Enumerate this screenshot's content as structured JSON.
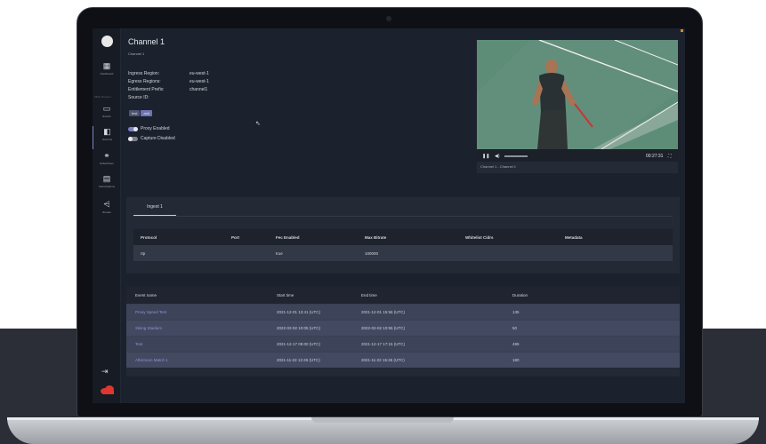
{
  "sidebar": {
    "items": [
      {
        "label": "Dashboard",
        "icon": "dashboard-icon"
      },
      {
        "label": "Events",
        "icon": "events-icon"
      },
      {
        "label": "Sources",
        "icon": "sources-icon"
      },
      {
        "label": "Subscribers",
        "icon": "subscribers-icon"
      },
      {
        "label": "Subscriptions",
        "icon": "subscriptions-icon"
      },
      {
        "label": "Routes",
        "icon": "routes-icon"
      }
    ],
    "section_label": "MDA Channel"
  },
  "channel": {
    "title": "Channel 1",
    "subtitle": "Channel 1",
    "ingress_region_label": "Ingress Region:",
    "ingress_region_value": "eu-west-1",
    "egress_regions_label": "Egress Regions:",
    "egress_regions_value": "eu-west-1",
    "entitlement_prefix_label": "Entitlement Prefix:",
    "entitlement_prefix_value": "channel1",
    "source_id_label": "Source ID:",
    "tags": [
      "test",
      "add"
    ],
    "proxy_label": "Proxy Enabled",
    "capture_label": "Capture Disabled",
    "proxy_enabled": true,
    "capture_enabled": false
  },
  "player": {
    "time": "00:27:31",
    "caption": "Channel 1 - Channel 1",
    "progress": 0.4
  },
  "ingest": {
    "tab_label": "Ingest 1",
    "headers": [
      "Protocol",
      "Port",
      "Fec Enabled",
      "Max Bitrate",
      "Whitelist Cidrs",
      "Metadata"
    ],
    "row": [
      "rtp",
      "",
      "true",
      "100000",
      "",
      ""
    ]
  },
  "events": {
    "headers": [
      "Event name",
      "Start time",
      "End time",
      "Duration"
    ],
    "rows": [
      [
        "Proxy Speed Test",
        "2021-12-01 13:41 (UTC)",
        "2021-12-01 15:56 (UTC)",
        "135"
      ],
      [
        "Skiing Stadium",
        "2022-02-02 10:05 (UTC)",
        "2022-02-02 10:55 (UTC)",
        "50"
      ],
      [
        "Test",
        "2021-12-17 09:00 (UTC)",
        "2021-12-17 17:15 (UTC)",
        "495"
      ],
      [
        "Afternoon Match 1",
        "2021-11-22 12:45 (UTC)",
        "2021-11-22 15:45 (UTC)",
        "180"
      ]
    ]
  },
  "colors": {
    "accent": "#7c82c4",
    "panel": "#232935",
    "background": "#1c222d"
  }
}
